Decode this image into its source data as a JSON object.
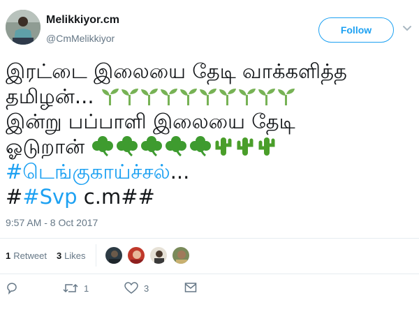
{
  "user": {
    "display_name": "Melikkiyor.cm",
    "handle": "@CmMelikkiyor"
  },
  "follow_button": {
    "label": "Follow"
  },
  "tweet": {
    "lines": [
      {
        "text": "இரட்டை இலையை தேடி வாக்களித்த"
      },
      {
        "text": "தமிழன்...",
        "emoji": "🌱🌱🌱🌱🌱🌱🌱🌱🌱🌱"
      },
      {
        "text": "இன்று பப்பாளி இலையை தேடி"
      },
      {
        "text": "ஓடுறான்",
        "emoji": "☘☘☘☘☘🌵🌵🌵"
      },
      {
        "hashtag": "#டெங்குகாய்ச்சல்",
        "suffix": "..."
      },
      {
        "prefix": "#",
        "hashtag": "#Svp",
        "suffix": " c.m##"
      }
    ]
  },
  "timestamp": "9:57 AM - 8 Oct 2017",
  "stats": {
    "retweets_count": "1",
    "retweets_label": "Retweet",
    "likes_count": "3",
    "likes_label": "Likes"
  },
  "actions": {
    "reply_icon": "reply-icon",
    "retweet_icon": "retweet-icon",
    "retweet_count": "1",
    "like_icon": "heart-icon",
    "like_count": "3",
    "dm_icon": "envelope-icon"
  },
  "colors": {
    "accent": "#1da1f2",
    "secondary_text": "#657786",
    "divider": "#e6ecf0",
    "seedling_green": "#77b255",
    "clover_green": "#3e9b2f",
    "cactus_green": "#4a9e2a"
  }
}
